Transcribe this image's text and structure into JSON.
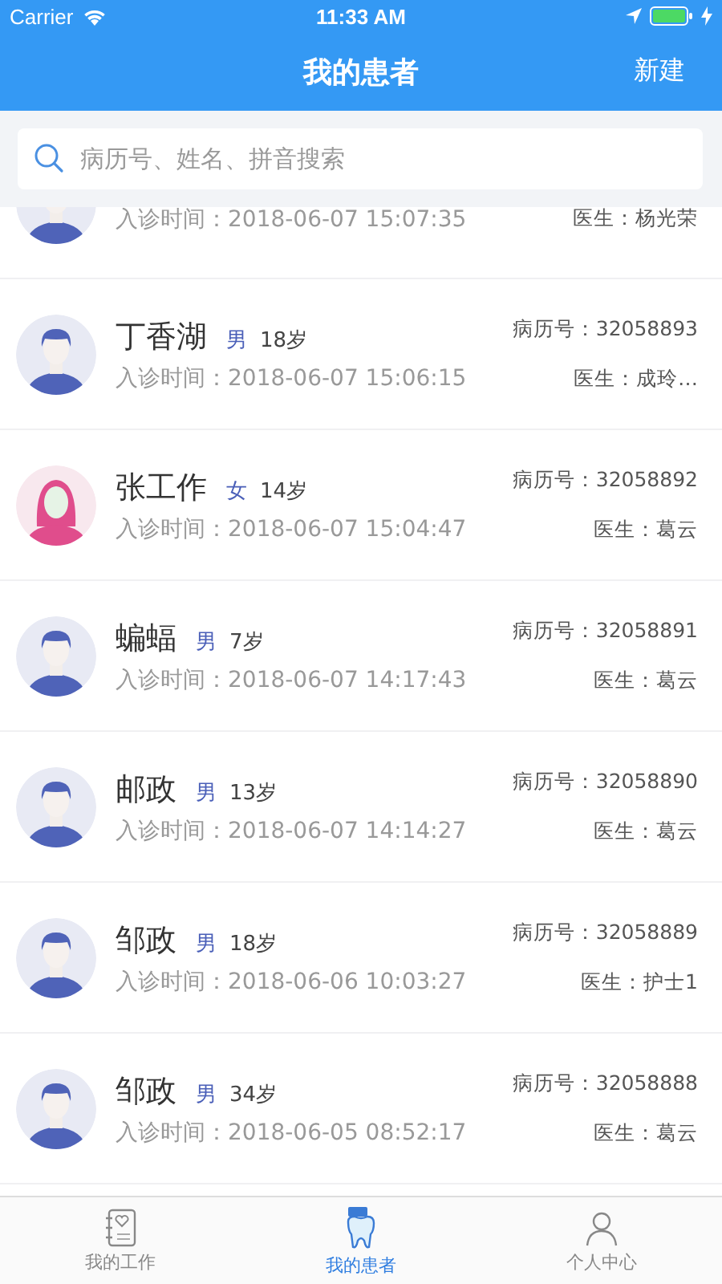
{
  "status_bar": {
    "carrier": "Carrier",
    "time": "11:33 AM"
  },
  "nav": {
    "title": "我的患者",
    "action": "新建"
  },
  "search": {
    "placeholder": "病历号、姓名、拼音搜索"
  },
  "patients": [
    {
      "kind": "male",
      "visit_time": "入诊时间：2018-06-07 15:07:35",
      "doctor": "医生：杨光荣"
    },
    {
      "kind": "male",
      "name": "丁香湖",
      "gender": "男",
      "age": "18岁",
      "record": "病历号：32058893",
      "visit_time": "入诊时间：2018-06-07 15:06:15",
      "doctor": "医生：成玲…"
    },
    {
      "kind": "female",
      "name": "张工作",
      "gender": "女",
      "age": "14岁",
      "record": "病历号：32058892",
      "visit_time": "入诊时间：2018-06-07 15:04:47",
      "doctor": "医生：葛云"
    },
    {
      "kind": "male",
      "name": "蝙蝠",
      "gender": "男",
      "age": "7岁",
      "record": "病历号：32058891",
      "visit_time": "入诊时间：2018-06-07 14:17:43",
      "doctor": "医生：葛云"
    },
    {
      "kind": "male",
      "name": "邮政",
      "gender": "男",
      "age": "13岁",
      "record": "病历号：32058890",
      "visit_time": "入诊时间：2018-06-07 14:14:27",
      "doctor": "医生：葛云"
    },
    {
      "kind": "male",
      "name": "邹政",
      "gender": "男",
      "age": "18岁",
      "record": "病历号：32058889",
      "visit_time": "入诊时间：2018-06-06 10:03:27",
      "doctor": "医生：护士1"
    },
    {
      "kind": "male",
      "name": "邹政",
      "gender": "男",
      "age": "34岁",
      "record": "病历号：32058888",
      "visit_time": "入诊时间：2018-06-05 08:52:17",
      "doctor": "医生：葛云"
    }
  ],
  "tabs": [
    {
      "label": "我的工作",
      "selected": false
    },
    {
      "label": "我的患者",
      "selected": true
    },
    {
      "label": "个人中心",
      "selected": false
    }
  ]
}
